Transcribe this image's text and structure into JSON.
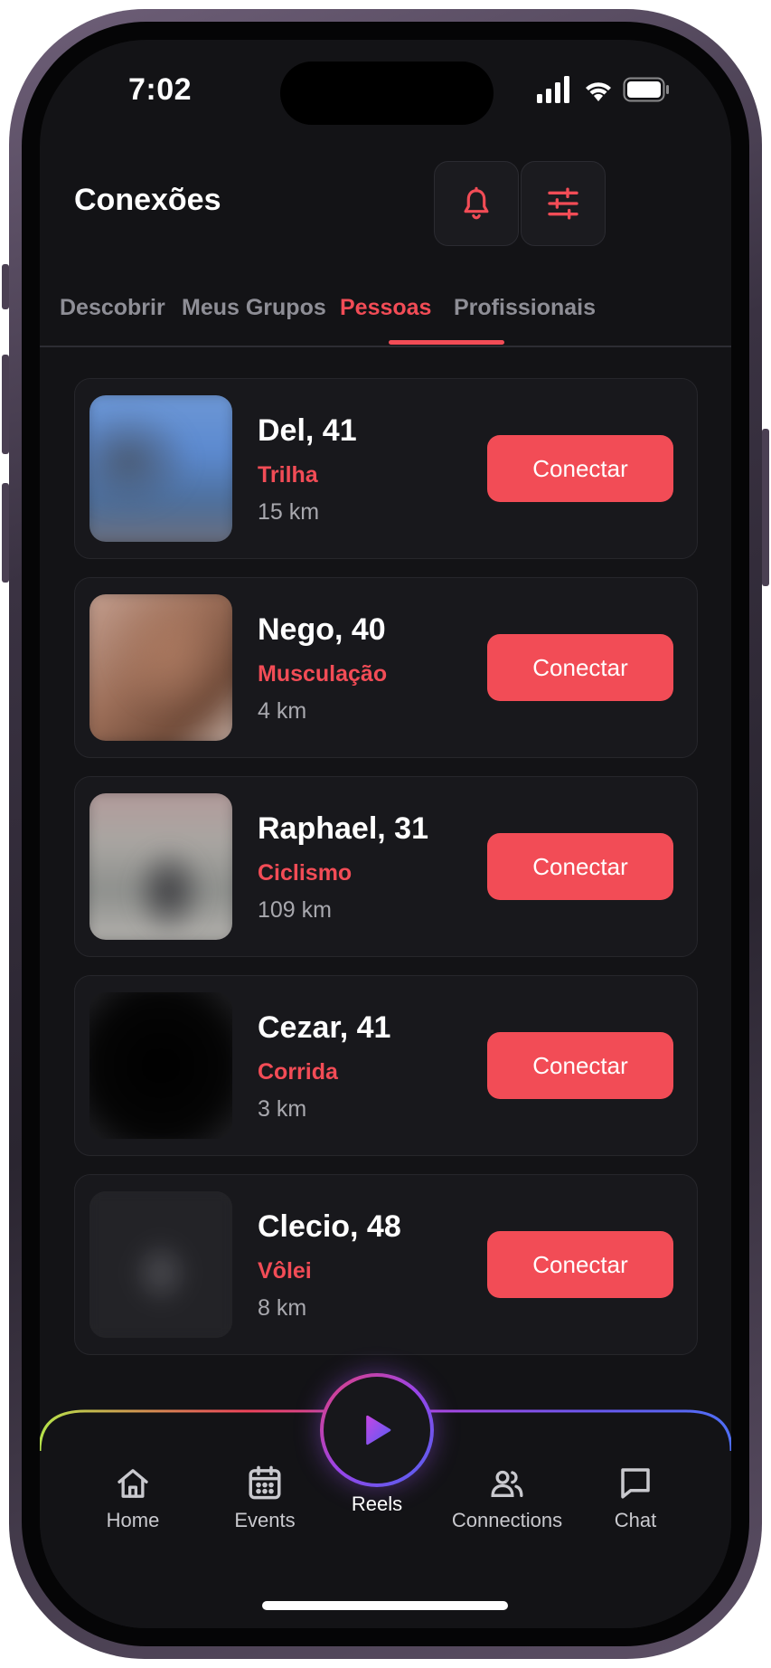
{
  "status_bar": {
    "time": "7:02"
  },
  "header": {
    "title": "Conexões"
  },
  "tabs": [
    {
      "label": "Descobrir",
      "active": false
    },
    {
      "label": "Meus Grupos",
      "active": false
    },
    {
      "label": "Pessoas",
      "active": true
    },
    {
      "label": "Profissionais",
      "active": false
    }
  ],
  "people": [
    {
      "name": "Del, 41",
      "sport": "Trilha",
      "distance": "15 km",
      "button": "Conectar"
    },
    {
      "name": "Nego, 40",
      "sport": "Musculação",
      "distance": "4 km",
      "button": "Conectar"
    },
    {
      "name": "Raphael, 31",
      "sport": "Ciclismo",
      "distance": "109 km",
      "button": "Conectar"
    },
    {
      "name": "Cezar, 41",
      "sport": "Corrida",
      "distance": "3 km",
      "button": "Conectar"
    },
    {
      "name": "Clecio, 48",
      "sport": "Vôlei",
      "distance": "8 km",
      "button": "Conectar"
    }
  ],
  "bottom_nav": {
    "home": "Home",
    "events": "Events",
    "reels": "Reels",
    "connections": "Connections",
    "chat": "Chat"
  },
  "icons": {
    "bell": "bell-icon",
    "filter": "sliders-icon",
    "home": "home-icon",
    "events": "calendar-icon",
    "reels": "play-icon",
    "connections": "users-icon",
    "chat": "chat-bubble-icon"
  },
  "colors": {
    "accent": "#f24c56",
    "background": "#131316",
    "card": "#18181c"
  }
}
